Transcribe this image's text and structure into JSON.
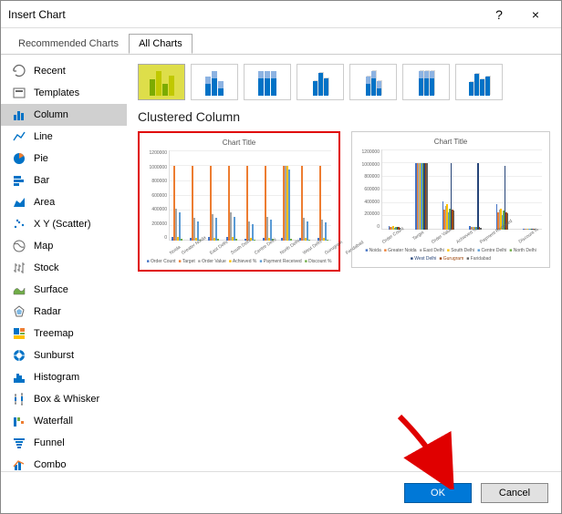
{
  "dialog": {
    "title": "Insert Chart",
    "help": "?",
    "close": "×"
  },
  "tabs": {
    "recommended": "Recommended Charts",
    "all": "All Charts"
  },
  "sidebar": {
    "items": [
      {
        "label": "Recent"
      },
      {
        "label": "Templates"
      },
      {
        "label": "Column"
      },
      {
        "label": "Line"
      },
      {
        "label": "Pie"
      },
      {
        "label": "Bar"
      },
      {
        "label": "Area"
      },
      {
        "label": "X Y (Scatter)"
      },
      {
        "label": "Map"
      },
      {
        "label": "Stock"
      },
      {
        "label": "Surface"
      },
      {
        "label": "Radar"
      },
      {
        "label": "Treemap"
      },
      {
        "label": "Sunburst"
      },
      {
        "label": "Histogram"
      },
      {
        "label": "Box & Whisker"
      },
      {
        "label": "Waterfall"
      },
      {
        "label": "Funnel"
      },
      {
        "label": "Combo"
      }
    ]
  },
  "subtype_name": "Clustered Column",
  "preview1": {
    "title": "Chart Title",
    "yticks": [
      "1200000",
      "1000000",
      "800000",
      "600000",
      "400000",
      "200000",
      "0"
    ],
    "categories": [
      "Noida",
      "Greater Noida",
      "East Delhi",
      "South Delhi",
      "Centre Delhi",
      "North Delhi",
      "West Delhi",
      "Gurugram",
      "Faridabad"
    ],
    "legend": [
      "Order Count",
      "Target",
      "Order Value",
      "Achieved %",
      "Payment Received",
      "Discount %"
    ]
  },
  "preview2": {
    "title": "Chart Title",
    "yticks": [
      "1200000",
      "1000000",
      "800000",
      "600000",
      "400000",
      "200000",
      "0"
    ],
    "categories": [
      "Order Count",
      "Target",
      "Order Value",
      "Achieved %",
      "Payment Received",
      "Discount %"
    ],
    "legend": [
      "Noida",
      "Greater Noida",
      "East Delhi",
      "South Delhi",
      "Centre Delhi",
      "North Delhi",
      "West Delhi",
      "Gurugram",
      "Faridabad"
    ]
  },
  "footer": {
    "ok": "OK",
    "cancel": "Cancel"
  },
  "chart_data": {
    "type": "bar",
    "title": "Chart Title",
    "ylim": [
      0,
      1200000
    ],
    "categories": [
      "Noida",
      "Greater Noida",
      "East Delhi",
      "South Delhi",
      "Centre Delhi",
      "North Delhi",
      "West Delhi",
      "Gurugram",
      "Faridabad"
    ],
    "series": [
      {
        "name": "Order Count",
        "values": [
          50000,
          40000,
          45000,
          48000,
          30000,
          42000,
          40000,
          35000,
          32000
        ]
      },
      {
        "name": "Target",
        "values": [
          1000000,
          1000000,
          1000000,
          1000000,
          1000000,
          1000000,
          1000000,
          1000000,
          1000000
        ]
      },
      {
        "name": "Order Value",
        "values": [
          420000,
          300000,
          350000,
          380000,
          260000,
          320000,
          1000000,
          300000,
          280000
        ]
      },
      {
        "name": "Achieved %",
        "values": [
          50000,
          40000,
          42000,
          44000,
          35000,
          40000,
          1000000,
          36000,
          34000
        ]
      },
      {
        "name": "Payment Received",
        "values": [
          380000,
          260000,
          300000,
          320000,
          220000,
          280000,
          950000,
          260000,
          240000
        ]
      },
      {
        "name": "Discount %",
        "values": [
          20000,
          18000,
          19000,
          19500,
          15000,
          18500,
          20000,
          16000,
          15500
        ]
      }
    ]
  }
}
